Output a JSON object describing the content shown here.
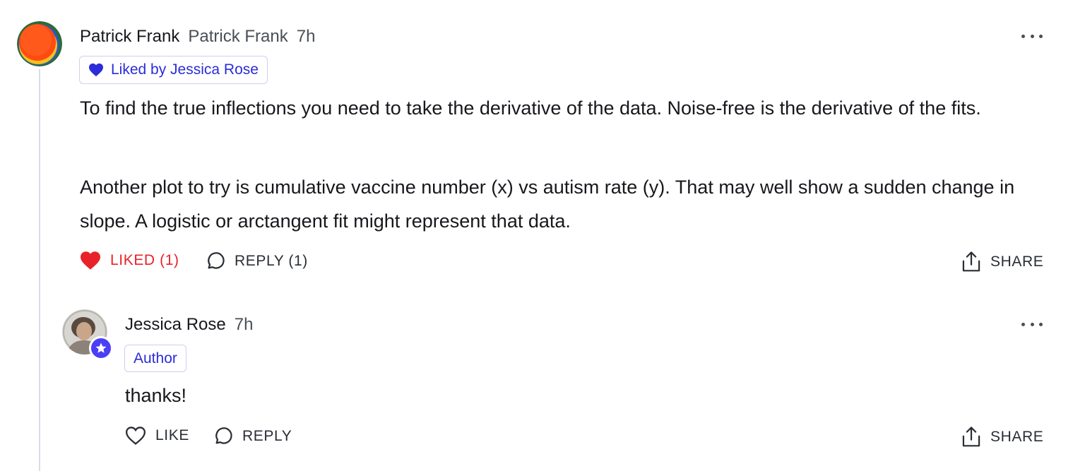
{
  "comment": {
    "author": "Patrick Frank",
    "handle": "Patrick Frank",
    "time": "7h",
    "liked_badge": "Liked by Jessica Rose",
    "paragraphs": [
      "To find the true inflections you need to take the derivative of the data. Noise-free is the derivative of the fits.",
      "Another plot to try is cumulative vaccine number (x) vs autism rate (y). That may well show a sudden change in slope. A logistic or arctangent fit might represent that data."
    ],
    "actions": {
      "like_label": "LIKED (1)",
      "reply_label": "REPLY (1)",
      "share_label": "SHARE"
    }
  },
  "reply": {
    "author": "Jessica Rose",
    "time": "7h",
    "badge": "Author",
    "text": "thanks!",
    "actions": {
      "like_label": "LIKE",
      "reply_label": "REPLY",
      "share_label": "SHARE"
    }
  },
  "colors": {
    "liked_red": "#e8222a",
    "badge_blue": "#2c2cd8",
    "author_star": "#4b3ff5",
    "thread_line": "#d9dde3"
  },
  "icons": [
    "ellipsis-icon",
    "heart-icon",
    "comment-bubble-icon",
    "share-icon",
    "star-icon"
  ]
}
